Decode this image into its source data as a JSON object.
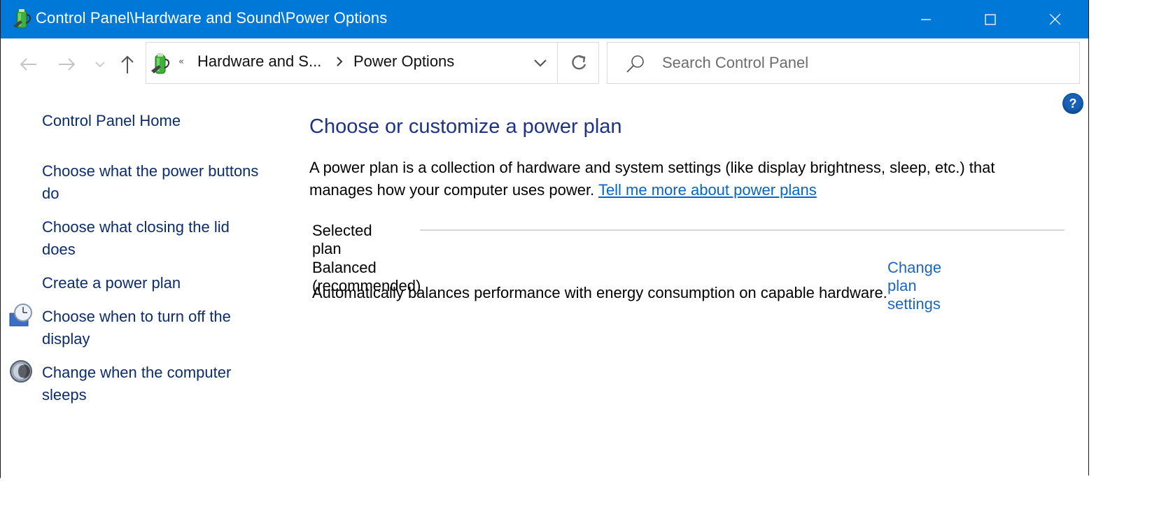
{
  "window": {
    "title": "Control Panel\\Hardware and Sound\\Power Options",
    "accent_color": "#0078d7",
    "controls": [
      "minimize",
      "maximize",
      "close"
    ]
  },
  "navigation": {
    "back_label": "Back",
    "forward_label": "Forward",
    "recent_label": "Recent locations",
    "up_label": "Up",
    "breadcrumb": {
      "overflow_glyph": "«",
      "items": [
        "Hardware and S...",
        "Power Options"
      ]
    },
    "refresh_label": "Refresh"
  },
  "search": {
    "placeholder": "Search Control Panel",
    "value": ""
  },
  "help": {
    "label": "?"
  },
  "sidebar": {
    "items": [
      {
        "label": "Control Panel Home",
        "icon": null
      },
      {
        "label": "Choose what the power buttons do",
        "icon": null
      },
      {
        "label": "Choose what closing the lid does",
        "icon": null
      },
      {
        "label": "Create a power plan",
        "icon": null
      },
      {
        "label": "Choose when to turn off the display",
        "icon": "monitor-clock-icon"
      },
      {
        "label": "Change when the computer sleeps",
        "icon": "moon-icon"
      }
    ]
  },
  "main": {
    "heading": "Choose or customize a power plan",
    "description": "A power plan is a collection of hardware and system settings (like display brightness, sleep, etc.) that manages how your computer uses power.",
    "learn_more_link": "Tell me more about power plans",
    "group_label": "Selected plan",
    "plan": {
      "name": "Balanced (recommended)",
      "change_link": "Change plan settings",
      "description": "Automatically balances performance with energy consumption on capable hardware."
    }
  }
}
